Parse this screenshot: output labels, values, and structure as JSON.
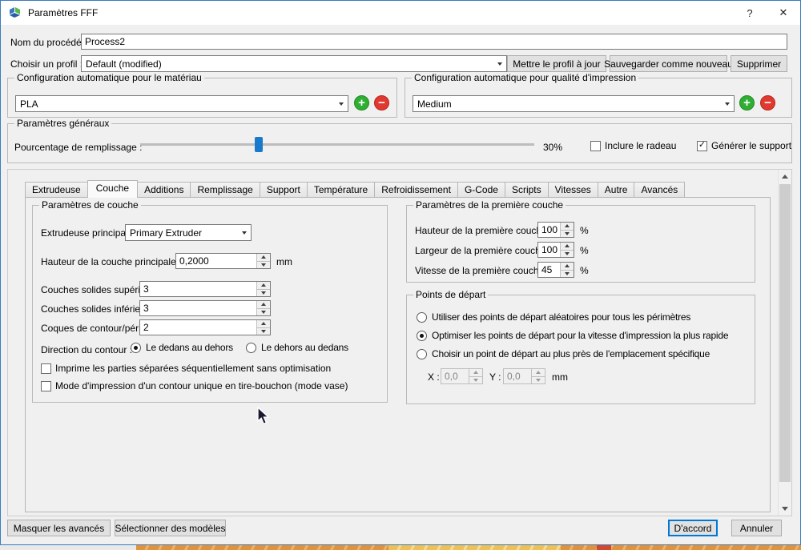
{
  "colors": {
    "accent_blue": "#0078d7",
    "slider_handle_blue": "#1979ca",
    "add_green": "#2fae33",
    "remove_red": "#e0392f",
    "window_border_blue": "#3a7bbf"
  },
  "icons": {
    "app": "simplify3d-logo",
    "help": "?",
    "close": "✕",
    "check": "✓",
    "add": "+",
    "remove": "−"
  },
  "window": {
    "title": "Paramètres FFF"
  },
  "header": {
    "process_name_label": "Nom du procédé :",
    "process_name_value": "Process2",
    "profile_label": "Choisir un profil :",
    "profile_value": "Default (modified)",
    "update_profile_button": "Mettre le profil à jour",
    "save_new_button": "Sauvegarder comme nouveau",
    "delete_button": "Supprimer"
  },
  "auto_material": {
    "title": "Configuration automatique pour le matériau",
    "selected": "PLA"
  },
  "auto_quality": {
    "title": "Configuration automatique pour qualité d'impression",
    "selected": "Medium"
  },
  "general": {
    "title": "Paramètres généraux",
    "infill_label": "Pourcentage de remplissage :",
    "infill_percent": 30,
    "infill_value_text": "30%",
    "raft_label": "Inclure le radeau",
    "raft_checked": false,
    "support_label": "Générer le support",
    "support_checked": true
  },
  "tabs": [
    "Extrudeuse",
    "Couche",
    "Additions",
    "Remplissage",
    "Support",
    "Température",
    "Refroidissement",
    "G-Code",
    "Scripts",
    "Vitesses",
    "Autre",
    "Avancés"
  ],
  "selected_tab": "Couche",
  "layer": {
    "title": "Paramètres de couche",
    "primary_extruder_label": "Extrudeuse principale",
    "primary_extruder_value": "Primary Extruder",
    "layer_height_label": "Hauteur de la couche principale",
    "layer_height_value": "0,2000",
    "layer_height_unit": "mm",
    "top_solid_label": "Couches solides supérieures",
    "top_solid_value": "3",
    "bottom_solid_label": "Couches solides inférieures",
    "bottom_solid_value": "3",
    "perimeter_label": "Coques de contour/périmètre",
    "perimeter_value": "2",
    "direction_label": "Direction du contour :",
    "direction_options": [
      {
        "label": "Le dedans au dehors",
        "selected": true
      },
      {
        "label": "Le dehors au dedans",
        "selected": false
      }
    ],
    "sequential_label": "Imprime les parties séparées séquentiellement sans optimisation",
    "sequential_checked": false,
    "vase_label": "Mode d'impression d'un contour unique en tire-bouchon (mode vase)",
    "vase_checked": false
  },
  "first_layer": {
    "title": "Paramètres de la première couche",
    "rows": [
      {
        "label": "Hauteur de la première couche",
        "value": "100",
        "unit": "%"
      },
      {
        "label": "Largeur de la première couche",
        "value": "100",
        "unit": "%"
      },
      {
        "label": "Vitesse de la première couche",
        "value": "45",
        "unit": "%"
      }
    ]
  },
  "start_points": {
    "title": "Points de départ",
    "options": [
      {
        "label": "Utiliser des points de départ aléatoires pour tous les périmètres",
        "selected": false
      },
      {
        "label": "Optimiser les points de départ pour la vitesse d'impression la plus rapide",
        "selected": true
      },
      {
        "label": "Choisir un point de départ au plus près de l'emplacement spécifique",
        "selected": false
      }
    ],
    "x_label": "X :",
    "x_value": "0,0",
    "y_label": "Y :",
    "y_value": "0,0",
    "unit": "mm"
  },
  "footer": {
    "hide_advanced_button": "Masquer les avancés",
    "select_models_button": "Sélectionner des modèles",
    "ok_button": "D'accord",
    "cancel_button": "Annuler"
  }
}
